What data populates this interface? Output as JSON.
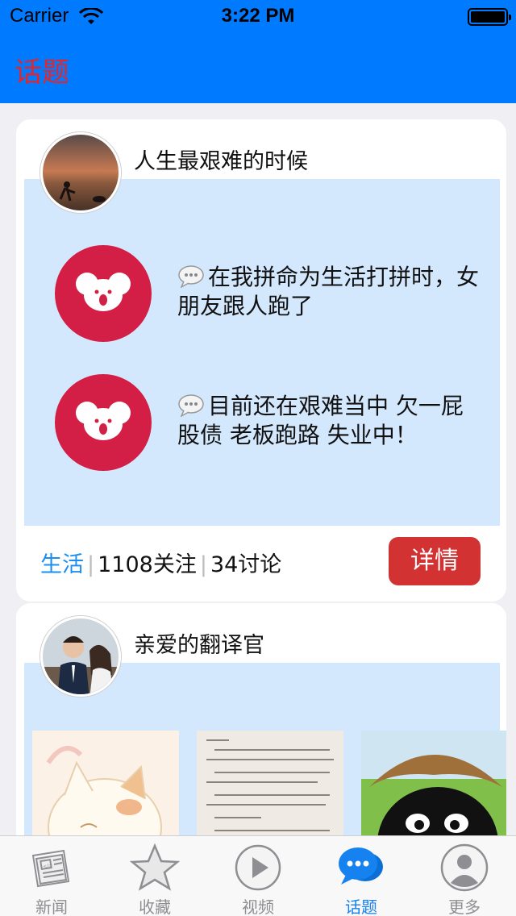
{
  "status_bar": {
    "carrier": "Carrier",
    "time": "3:22 PM"
  },
  "nav": {
    "title": "话题"
  },
  "topics": [
    {
      "title": "人生最艰难的时候",
      "messages": [
        {
          "text": "在我拼命为生活打拼时，女朋友跟人跑了"
        },
        {
          "text": "目前还在艰难当中 欠一屁股债 老板跑路 失业中！"
        }
      ],
      "tag": "生活",
      "followers": "1108关注",
      "discussions": "34讨论",
      "detail_label": "详情"
    },
    {
      "title": "亲爱的翻译官",
      "thumbnails": [
        "cartoon-cat-image",
        "book-page-image",
        "bear-mascot-image"
      ]
    }
  ],
  "tabbar": {
    "items": [
      {
        "label": "新闻",
        "icon": "newspaper-icon",
        "active": false
      },
      {
        "label": "收藏",
        "icon": "star-icon",
        "active": false
      },
      {
        "label": "视频",
        "icon": "play-icon",
        "active": false
      },
      {
        "label": "话题",
        "icon": "chat-bubble-icon",
        "active": true
      },
      {
        "label": "更多",
        "icon": "person-icon",
        "active": false
      }
    ]
  },
  "colors": {
    "nav_bg": "#007aff",
    "nav_title": "#e3262b",
    "panel_bg": "#d3e7fd",
    "koala_bg": "#d31f45",
    "tag": "#1b8ef2",
    "button": "#d23232",
    "tab_active": "#1682ef"
  }
}
